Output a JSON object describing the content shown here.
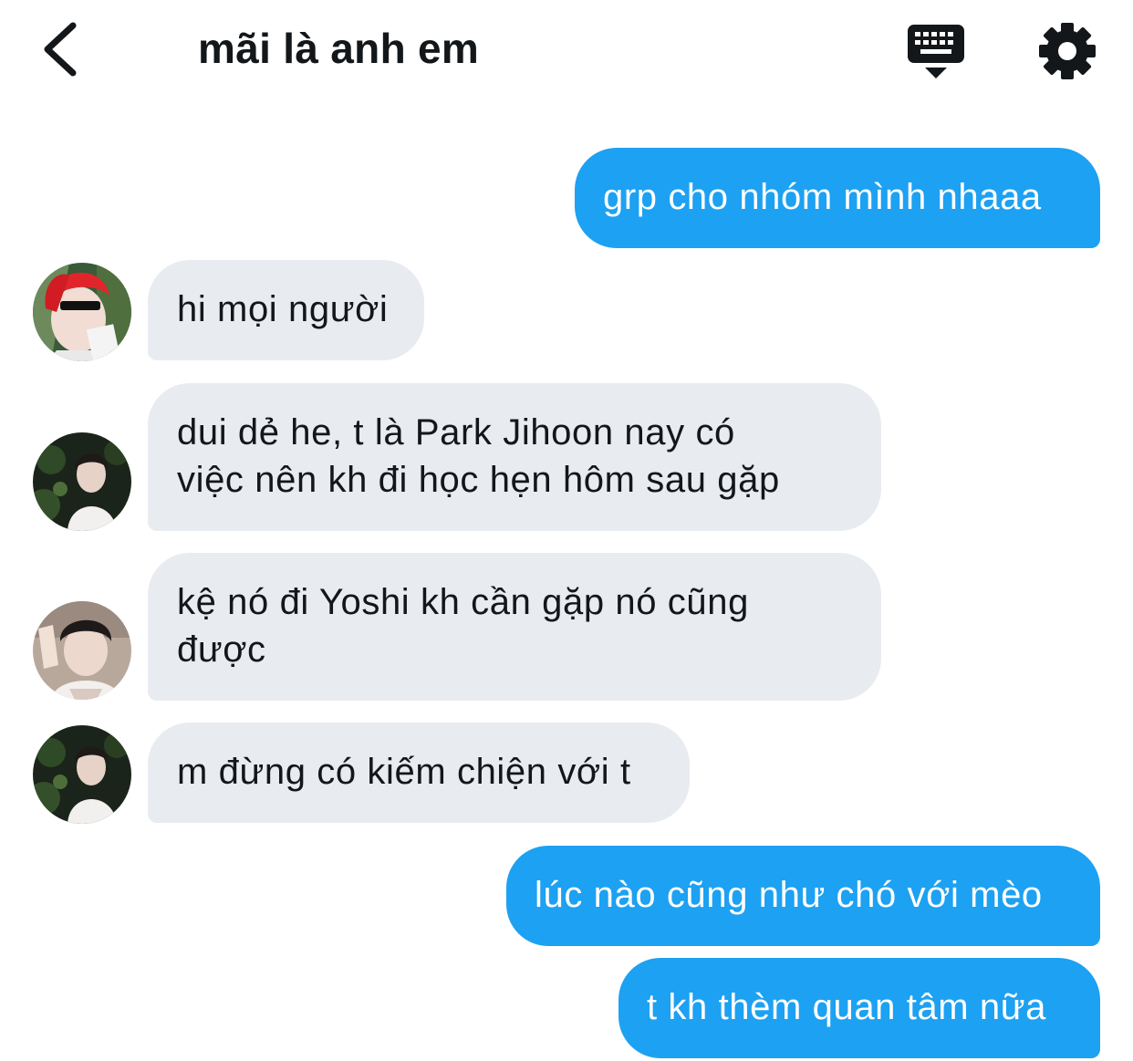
{
  "header": {
    "title": "mãi là anh em",
    "back_icon": "chevron-left-icon",
    "keyboard_icon": "keyboard-icon",
    "settings_icon": "gear-icon"
  },
  "colors": {
    "outgoing_bubble": "#1da1f2",
    "incoming_bubble": "#e8ecf0",
    "text": "#14171a"
  },
  "messages": [
    {
      "direction": "outgoing",
      "lines": [
        "grp cho nhóm mình nhaaa"
      ]
    },
    {
      "direction": "incoming",
      "avatar": "avatar-red-hair",
      "lines": [
        "hi mọi người"
      ]
    },
    {
      "direction": "incoming",
      "avatar": "avatar-dark-forest",
      "lines": [
        "dui dẻ he, t là Park Jihoon nay có",
        "việc nên kh đi học hẹn hôm sau gặp"
      ]
    },
    {
      "direction": "incoming",
      "avatar": "avatar-selfie",
      "lines": [
        "kệ nó đi Yoshi kh cần gặp nó cũng",
        "được"
      ]
    },
    {
      "direction": "incoming",
      "avatar": "avatar-dark-forest",
      "lines": [
        "m đừng có kiếm chiện với t"
      ]
    },
    {
      "direction": "outgoing",
      "lines": [
        "lúc nào cũng như chó với mèo"
      ]
    },
    {
      "direction": "outgoing",
      "lines": [
        "t kh thèm quan tâm nữa"
      ]
    }
  ]
}
